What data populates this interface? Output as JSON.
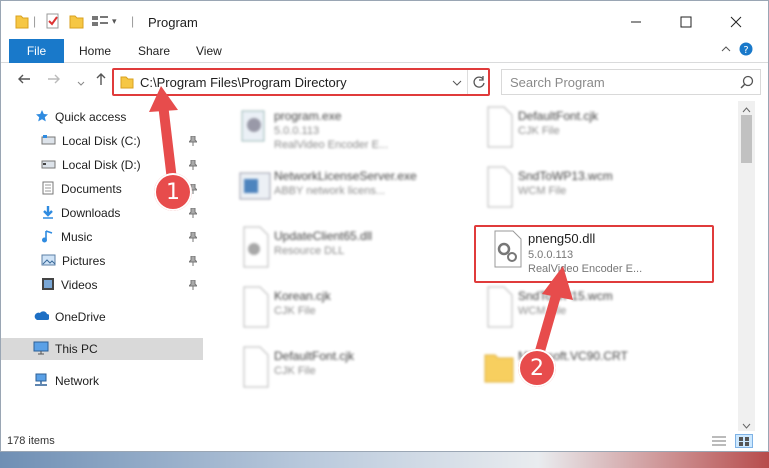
{
  "window": {
    "title": "Program"
  },
  "ribbon": {
    "tabs": [
      "File",
      "Home",
      "Share",
      "View"
    ]
  },
  "address": {
    "path": "C:\\Program Files\\Program Directory",
    "search_placeholder": "Search Program"
  },
  "sidebar": {
    "quick_access": "Quick access",
    "items": [
      {
        "label": "Local Disk (C:)",
        "icon": "drive-icon",
        "pinned": true
      },
      {
        "label": "Local Disk (D:)",
        "icon": "drive-icon",
        "pinned": true
      },
      {
        "label": "Documents",
        "icon": "documents-icon",
        "pinned": true
      },
      {
        "label": "Downloads",
        "icon": "downloads-icon",
        "pinned": true
      },
      {
        "label": "Music",
        "icon": "music-icon",
        "pinned": true
      },
      {
        "label": "Pictures",
        "icon": "pictures-icon",
        "pinned": true
      },
      {
        "label": "Videos",
        "icon": "videos-icon",
        "pinned": true
      }
    ],
    "onedrive": "OneDrive",
    "this_pc": "This PC",
    "network": "Network"
  },
  "files": [
    {
      "name": "program.exe",
      "line1": "5.0.0.113",
      "line2": "RealVideo Encoder E..."
    },
    {
      "name": "DefaultFont.cjk",
      "line1": "CJK File",
      "line2": ""
    },
    {
      "name": "NetworkLicenseServer.exe",
      "line1": "ABBY network licens...",
      "line2": ""
    },
    {
      "name": "SndToWP13.wcm",
      "line1": "WCM File",
      "line2": ""
    },
    {
      "name": "UpdateClient65.dll",
      "line1": "Resource DLL",
      "line2": ""
    },
    {
      "name": "pneng50.dll",
      "line1": "5.0.0.113",
      "line2": "RealVideo Encoder E..."
    },
    {
      "name": "Korean.cjk",
      "line1": "CJK File",
      "line2": ""
    },
    {
      "name": "SndToWP15.wcm",
      "line1": "WCM File",
      "line2": ""
    },
    {
      "name": "DefaultFont.cjk",
      "line1": "CJK File",
      "line2": ""
    },
    {
      "name": "Microsoft.VC90.CRT",
      "line1": "",
      "line2": ""
    }
  ],
  "status": {
    "item_count": "178 items"
  },
  "badges": {
    "one": "1",
    "two": "2"
  },
  "colors": {
    "accent": "#1979ca",
    "highlight": "#e03b3b",
    "selected": "#cce8ff"
  }
}
